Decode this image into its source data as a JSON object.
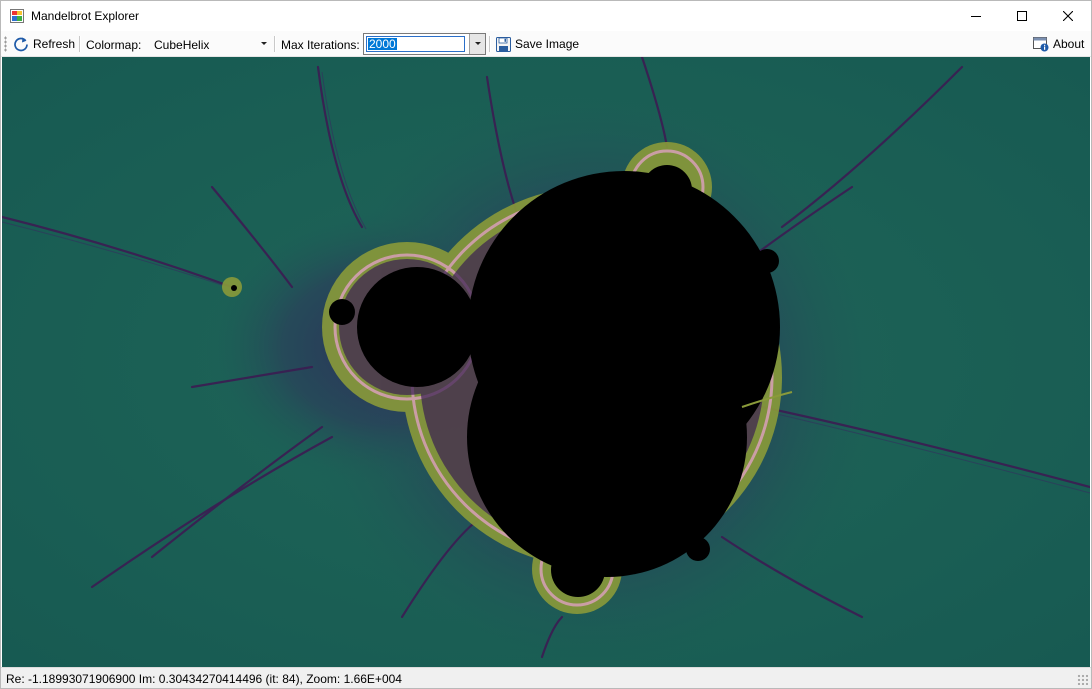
{
  "window": {
    "title": "Mandelbrot Explorer",
    "icons": {
      "app": "mandelbrot-app-icon",
      "minimize": "minimize-icon",
      "maximize": "maximize-icon",
      "close": "close-icon"
    }
  },
  "toolbar": {
    "refresh_label": "Refresh",
    "refresh_icon": "refresh-icon",
    "colormap_label": "Colormap:",
    "colormap_value": "CubeHelix",
    "max_iterations_label": "Max Iterations:",
    "max_iterations_value": "2000",
    "save_label": "Save Image",
    "save_icon": "save-disk-icon",
    "about_label": "About",
    "about_icon": "about-info-icon"
  },
  "fractal": {
    "colors": {
      "background": "#1c5e55",
      "outer_glow": "#2a3f5a",
      "filament": "#3a1f52",
      "edge_green": "#8a9a3a",
      "edge_pink": "#d8a0b8",
      "interior": "#000000"
    }
  },
  "status": {
    "text": "Re: -1.18993071906900 Im: 0.30434270414496 (it: 84), Zoom: 1.66E+004"
  }
}
